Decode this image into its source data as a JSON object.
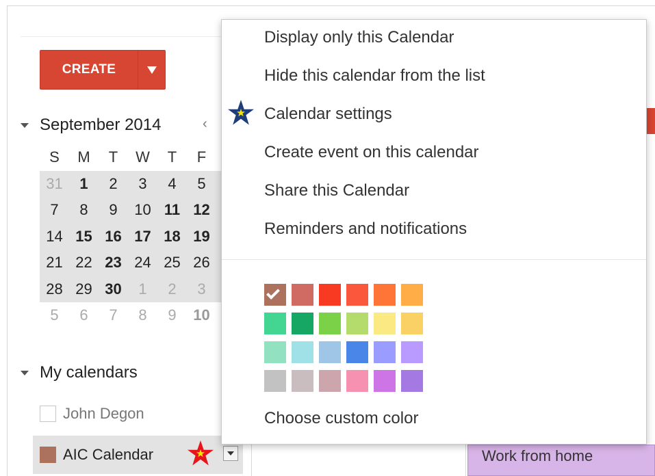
{
  "create": {
    "label": "CREATE"
  },
  "mini_calendar": {
    "month_label": "September 2014",
    "prev_label": "‹",
    "weekdays": [
      "S",
      "M",
      "T",
      "W",
      "T",
      "F"
    ],
    "weeks": [
      [
        "31",
        "1",
        "2",
        "3",
        "4",
        "5"
      ],
      [
        "7",
        "8",
        "9",
        "10",
        "11",
        "12"
      ],
      [
        "14",
        "15",
        "16",
        "17",
        "18",
        "19"
      ],
      [
        "21",
        "22",
        "23",
        "24",
        "25",
        "26"
      ],
      [
        "28",
        "29",
        "30",
        "1",
        "2",
        "3"
      ],
      [
        "5",
        "6",
        "7",
        "8",
        "9",
        "10"
      ]
    ]
  },
  "my_calendars": {
    "title": "My calendars",
    "items": [
      {
        "label": "John Degon",
        "checked": false
      },
      {
        "label": "AIC Calendar",
        "checked": true,
        "color": "#ac725e"
      }
    ]
  },
  "popup_menu": {
    "items": [
      {
        "label": "Display only this Calendar"
      },
      {
        "label": "Hide this calendar from the list"
      },
      {
        "label": "Calendar settings"
      },
      {
        "label": "Create event on this calendar"
      },
      {
        "label": "Share this Calendar"
      },
      {
        "label": "Reminders and notifications"
      }
    ],
    "palette": [
      [
        "#ac725e",
        "#d06b64",
        "#f83a22",
        "#fa573c",
        "#ff7537",
        "#ffad46"
      ],
      [
        "#42d692",
        "#16a765",
        "#7bd148",
        "#b3dc6c",
        "#fbe983",
        "#fad165"
      ],
      [
        "#92e1c0",
        "#9fe1e7",
        "#9fc6e7",
        "#4986e7",
        "#9a9cff",
        "#b99aff"
      ],
      [
        "#c2c2c2",
        "#cabdbf",
        "#cca6ac",
        "#f691b2",
        "#cd74e6",
        "#a47ae2"
      ]
    ],
    "selected_color": "#ac725e",
    "custom_color_label": "Choose custom color"
  },
  "background": {
    "event_label": "Work from home"
  },
  "annotations": {
    "blue_star_color": "#1f3d7a",
    "red_star_color": "#e8141c",
    "star_center_color": "#f5e400"
  }
}
